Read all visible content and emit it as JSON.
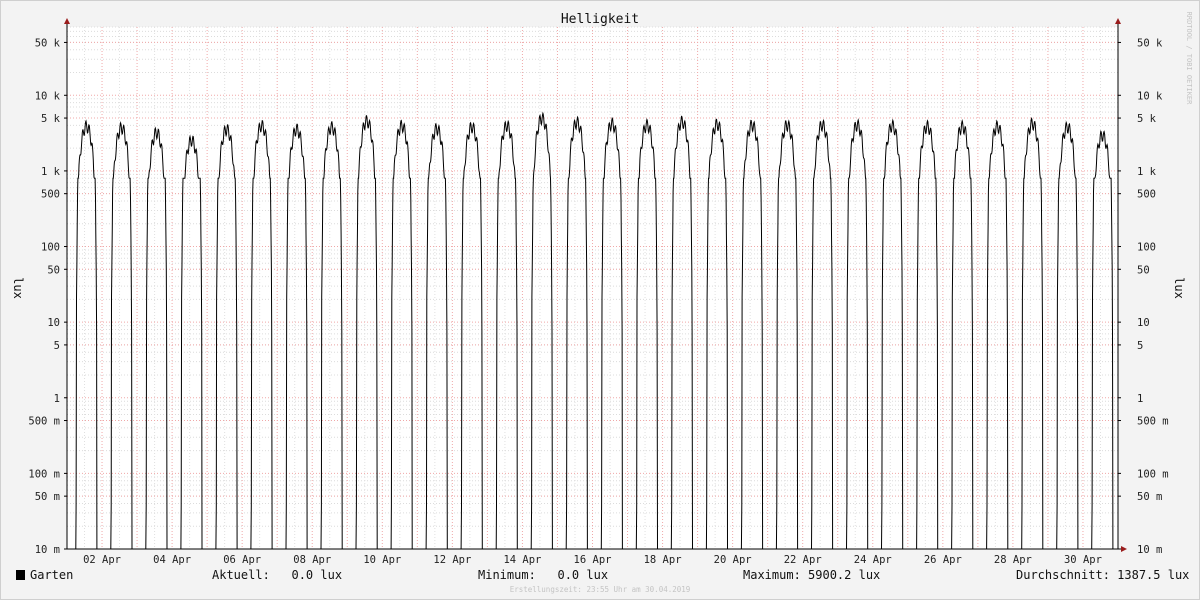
{
  "chart_data": {
    "type": "line",
    "title": "Helligkeit",
    "ylabel": "lux",
    "right_ylabel": "lux",
    "yscale": "log",
    "ylim": [
      0.01,
      80000
    ],
    "y_ticks": [
      {
        "value": 0.01,
        "label": "10 m"
      },
      {
        "value": 0.05,
        "label": "50 m"
      },
      {
        "value": 0.1,
        "label": "100 m"
      },
      {
        "value": 0.5,
        "label": "500 m"
      },
      {
        "value": 1,
        "label": "1"
      },
      {
        "value": 5,
        "label": "5"
      },
      {
        "value": 10,
        "label": "10"
      },
      {
        "value": 50,
        "label": "50"
      },
      {
        "value": 100,
        "label": "100"
      },
      {
        "value": 500,
        "label": "500"
      },
      {
        "value": 1000,
        "label": "1 k"
      },
      {
        "value": 5000,
        "label": "5 k"
      },
      {
        "value": 10000,
        "label": "10 k"
      },
      {
        "value": 50000,
        "label": "50 k"
      }
    ],
    "xlim": [
      "2019-04-01T00:00",
      "2019-05-01T00:00"
    ],
    "x_ticks": [
      "02 Apr",
      "04 Apr",
      "06 Apr",
      "08 Apr",
      "10 Apr",
      "12 Apr",
      "14 Apr",
      "16 Apr",
      "18 Apr",
      "20 Apr",
      "22 Apr",
      "24 Apr",
      "26 Apr",
      "28 Apr",
      "30 Apr"
    ],
    "grid": true,
    "series": [
      {
        "name": "Garten",
        "color": "#000000",
        "day_peaks_lux": [
          4600,
          4400,
          3800,
          3000,
          4200,
          4700,
          4200,
          4500,
          5400,
          4700,
          4300,
          4500,
          4700,
          5900,
          5200,
          5000,
          4800,
          5300,
          4900,
          4800,
          4800,
          4800,
          4800,
          4700,
          4600,
          4600,
          4600,
          5000,
          4500,
          3500
        ],
        "sunrise_hour": 6.2,
        "sunset_hour": 20.5,
        "night_value_lux": 0.0
      }
    ],
    "grid_color": "#f0a8a8",
    "arrow_color": "#9a1c1c"
  },
  "legend": {
    "series_label": "Garten",
    "current": "Aktuell:   0.0 lux",
    "minimum": "Minimum:   0.0 lux",
    "maximum": "Maximum: 5900.2 lux",
    "average": "Durchschnitt: 1387.5 lux"
  },
  "watermark": "RRDTOOL / TOBI OETIKER",
  "footer": "Erstellungszeit: 23:55 Uhr am 30.04.2019"
}
